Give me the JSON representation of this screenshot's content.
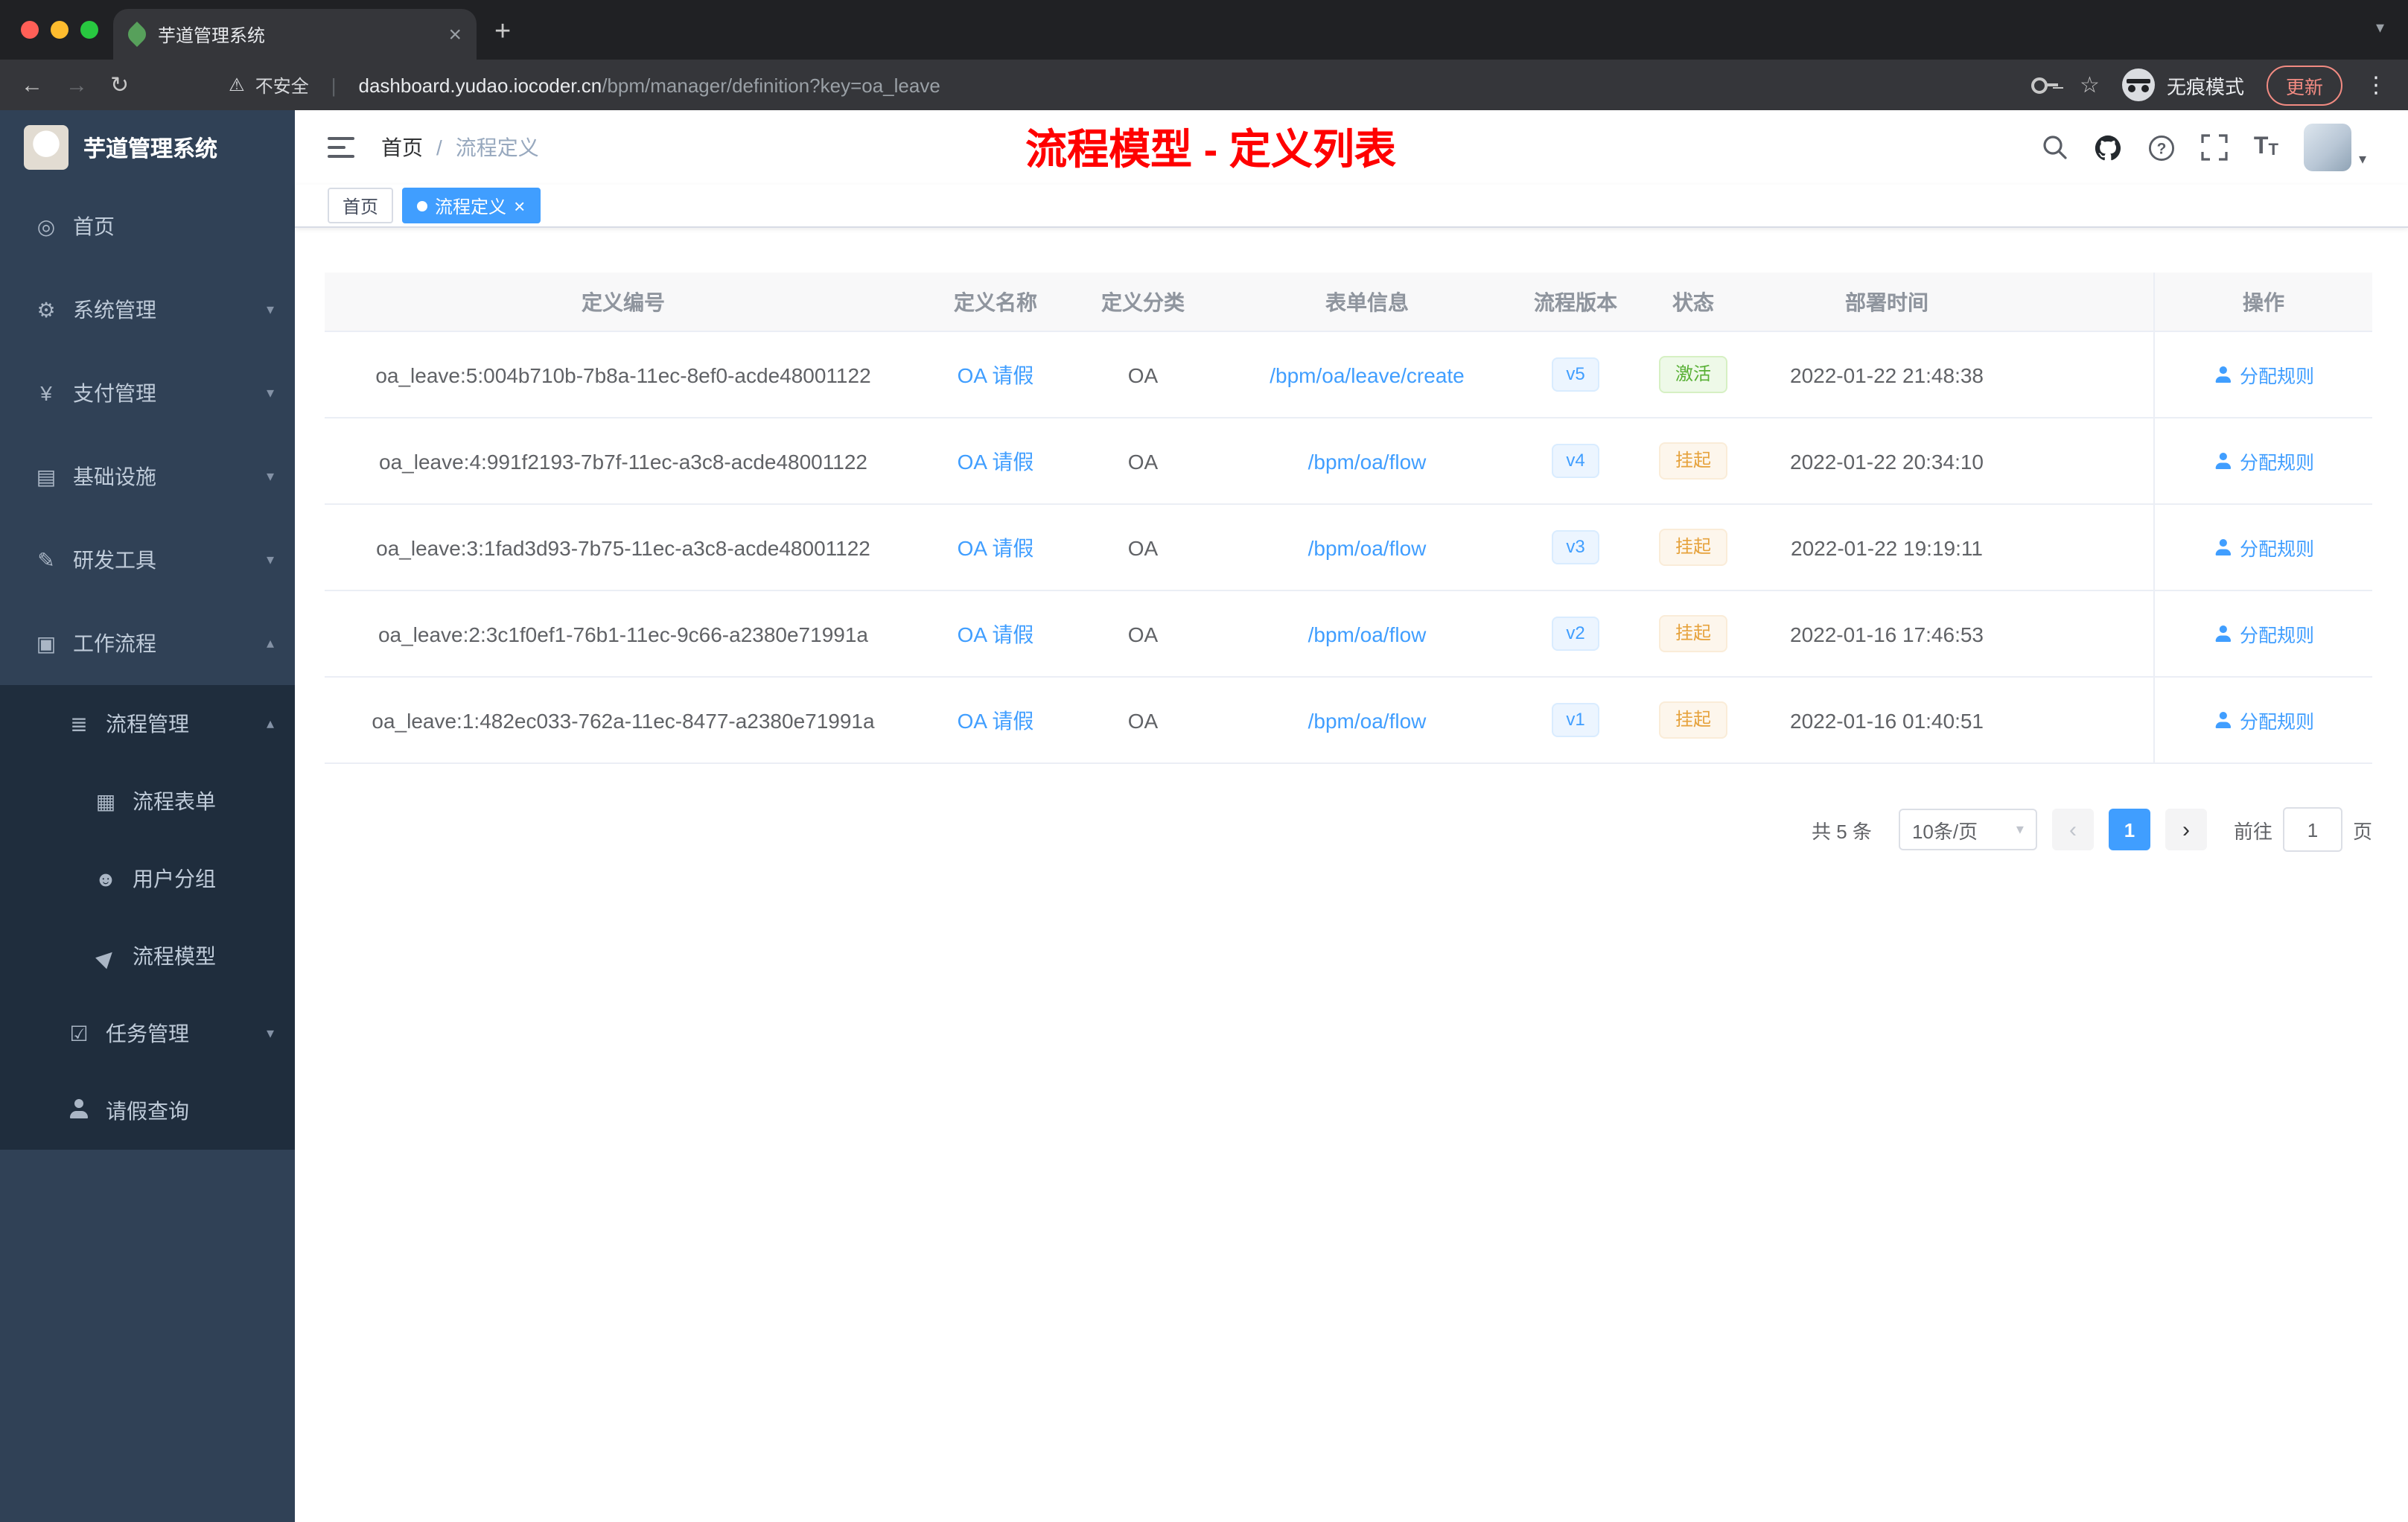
{
  "browser": {
    "tab_title": "芋道管理系统",
    "new_tab": "+",
    "tab_close": "×",
    "tab_search_caret": "▾",
    "back": "←",
    "forward": "→",
    "reload": "↻",
    "security_warning": "⚠",
    "security_label": "不安全",
    "url_separator": "|",
    "url_domain": "dashboard.yudao.iocoder.cn",
    "url_path": "/bpm/manager/definition?key=oa_leave",
    "star": "☆",
    "incognito_label": "无痕模式",
    "update_label": "更新",
    "menu_dots": "⋮"
  },
  "sidebar": {
    "title": "芋道管理系统",
    "menu": [
      {
        "label": "首页",
        "glyph": "◎"
      },
      {
        "label": "系统管理",
        "glyph": "⚙",
        "arrow": "▾"
      },
      {
        "label": "支付管理",
        "glyph": "¥",
        "arrow": "▾"
      },
      {
        "label": "基础设施",
        "glyph": "▤",
        "arrow": "▾"
      },
      {
        "label": "研发工具",
        "glyph": "✎",
        "arrow": "▾"
      },
      {
        "label": "工作流程",
        "glyph": "▣",
        "arrow": "▴"
      },
      {
        "label": "流程管理",
        "glyph": "≣",
        "arrow": "▴"
      },
      {
        "label": "流程表单",
        "glyph": "▦"
      },
      {
        "label": "用户分组",
        "glyph": "☻"
      },
      {
        "label": "流程模型",
        "glyph": "▶"
      },
      {
        "label": "任务管理",
        "glyph": "☑",
        "arrow": "▾"
      },
      {
        "label": "请假查询"
      }
    ]
  },
  "header": {
    "breadcrumb_home": "首页",
    "breadcrumb_sep": "/",
    "breadcrumb_current": "流程定义",
    "annotation": "流程模型 - 定义列表",
    "font_icon_large": "T",
    "font_icon_small": "T",
    "avatar_caret": "▾"
  },
  "tags": {
    "home": "首页",
    "active": "流程定义",
    "close": "×"
  },
  "table": {
    "columns": [
      "定义编号",
      "定义名称",
      "定义分类",
      "表单信息",
      "流程版本",
      "状态",
      "部署时间",
      "操作"
    ],
    "rows": [
      {
        "id": "oa_leave:5:004b710b-7b8a-11ec-8ef0-acde48001122",
        "name": "OA 请假",
        "category": "OA",
        "form": "/bpm/oa/leave/create",
        "version": "v5",
        "status": "激活",
        "time": "2022-01-22 21:48:38",
        "action": "分配规则"
      },
      {
        "id": "oa_leave:4:991f2193-7b7f-11ec-a3c8-acde48001122",
        "name": "OA 请假",
        "category": "OA",
        "form": "/bpm/oa/flow",
        "version": "v4",
        "status": "挂起",
        "time": "2022-01-22 20:34:10",
        "action": "分配规则"
      },
      {
        "id": "oa_leave:3:1fad3d93-7b75-11ec-a3c8-acde48001122",
        "name": "OA 请假",
        "category": "OA",
        "form": "/bpm/oa/flow",
        "version": "v3",
        "status": "挂起",
        "time": "2022-01-22 19:19:11",
        "action": "分配规则"
      },
      {
        "id": "oa_leave:2:3c1f0ef1-76b1-11ec-9c66-a2380e71991a",
        "name": "OA 请假",
        "category": "OA",
        "form": "/bpm/oa/flow",
        "version": "v2",
        "status": "挂起",
        "time": "2022-01-16 17:46:53",
        "action": "分配规则"
      },
      {
        "id": "oa_leave:1:482ec033-762a-11ec-8477-a2380e71991a",
        "name": "OA 请假",
        "category": "OA",
        "form": "/bpm/oa/flow",
        "version": "v1",
        "status": "挂起",
        "time": "2022-01-16 01:40:51",
        "action": "分配规则"
      }
    ]
  },
  "pagination": {
    "total": "共 5 条",
    "page_size": "10条/页",
    "size_caret": "▾",
    "prev": "‹",
    "page": "1",
    "next": "›",
    "goto_label": "前往",
    "goto_value": "1",
    "unit": "页"
  },
  "colors": {
    "accent": "#409eff",
    "sidebar_bg": "#304156",
    "submenu_bg": "#1f2d3d",
    "success": "#67c23a",
    "warning": "#e6a23c",
    "annotation_red": "#ff0000"
  }
}
